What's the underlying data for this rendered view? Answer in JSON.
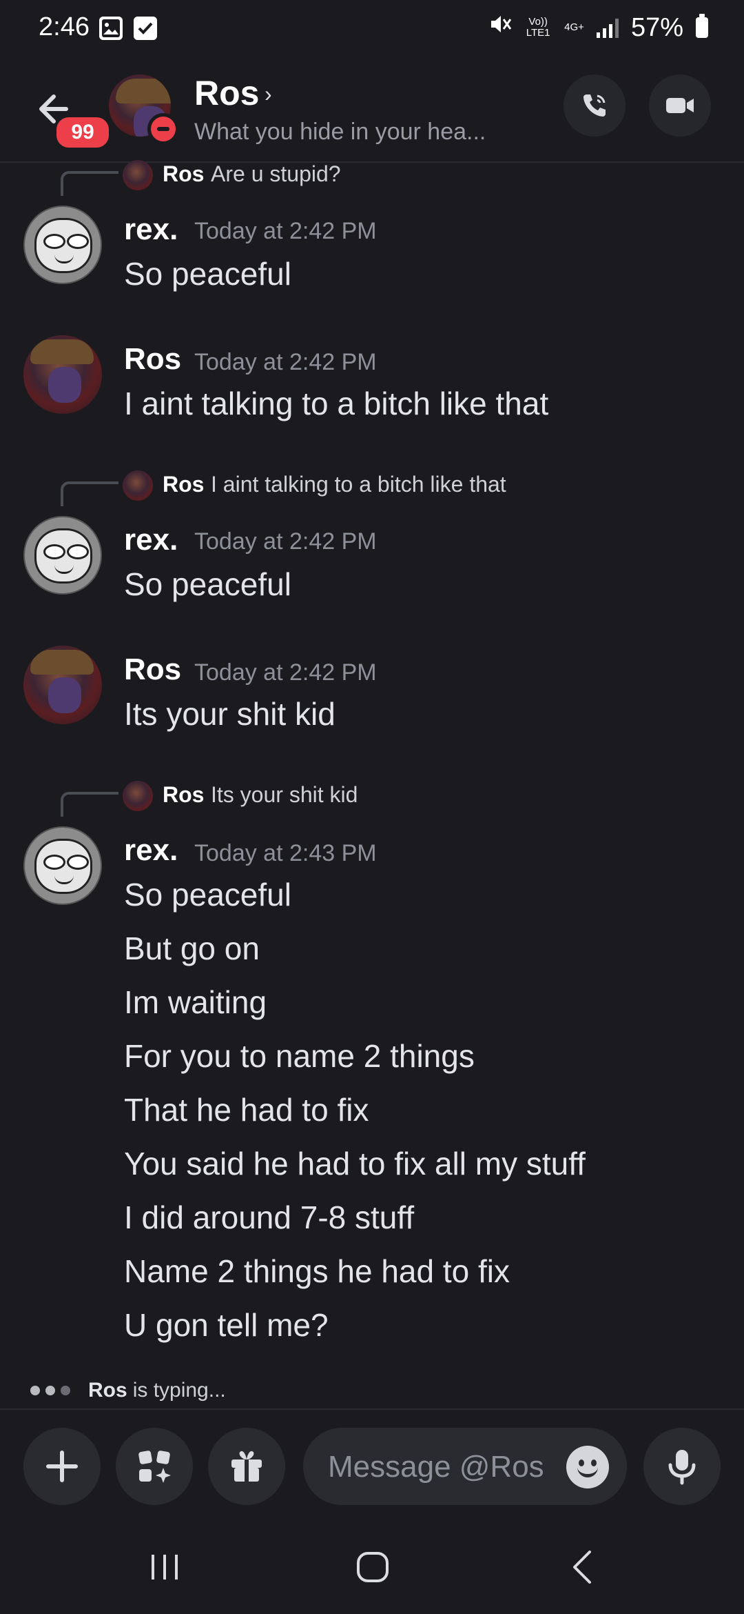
{
  "status_bar": {
    "time": "2:46",
    "volte_label": "Vo)) LTE1",
    "network_label": "4G+",
    "battery": "57%"
  },
  "header": {
    "unread_badge": "99",
    "name": "Ros",
    "chevron": "›",
    "status_text": "What you hide in your hea..."
  },
  "messages": [
    {
      "reply": {
        "name": "Ros",
        "text": "Are u stupid?"
      },
      "author": "rex.",
      "timestamp": "Today at 2:42 PM",
      "lines": [
        "So peaceful"
      ]
    },
    {
      "author": "Ros",
      "timestamp": "Today at 2:42 PM",
      "lines": [
        "I aint talking to a bitch like that"
      ]
    },
    {
      "reply": {
        "name": "Ros",
        "text": "I aint talking to a bitch like that"
      },
      "author": "rex.",
      "timestamp": "Today at 2:42 PM",
      "lines": [
        "So peaceful"
      ]
    },
    {
      "author": "Ros",
      "timestamp": "Today at 2:42 PM",
      "lines": [
        "Its your shit kid"
      ]
    },
    {
      "reply": {
        "name": "Ros",
        "text": "Its your shit kid"
      },
      "author": "rex.",
      "timestamp": "Today at 2:43 PM",
      "lines": [
        "So peaceful",
        "But go on",
        "Im waiting",
        "For you to name 2 things",
        "That he had to fix",
        "You said he had to fix all my stuff",
        "I did around 7-8 stuff",
        "Name 2 things he had to fix",
        "U gon tell me?"
      ]
    }
  ],
  "typing": {
    "name": "Ros",
    "text": "is typing..."
  },
  "composer": {
    "placeholder": "Message @Ros"
  },
  "icons": {
    "back": "back-arrow-icon",
    "call": "phone-icon",
    "video": "video-camera-icon",
    "add": "plus-icon",
    "apps": "apps-icon",
    "gift": "gift-icon",
    "emoji": "emoji-icon",
    "mic": "microphone-icon"
  },
  "colors": {
    "background": "#1b1b1f",
    "dnd_red": "#ec3f49",
    "text_muted": "#8e9099"
  }
}
